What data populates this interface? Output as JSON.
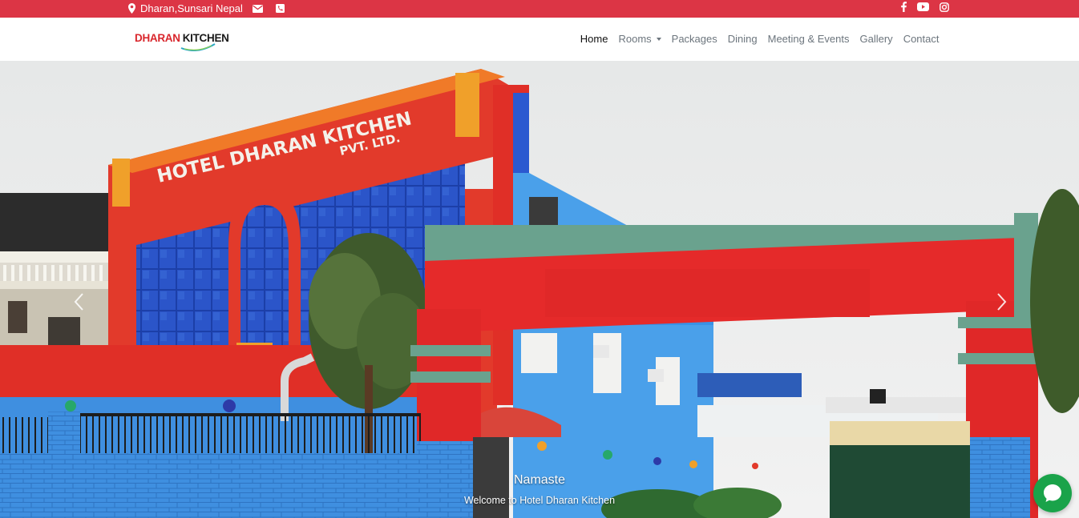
{
  "topbar": {
    "location": "Dharan,Sunsari Nepal",
    "left_icons": [
      "map-marker-icon",
      "envelope-icon",
      "phone-square-icon"
    ],
    "right_icons": [
      "facebook-icon",
      "youtube-icon",
      "instagram-icon"
    ],
    "color": "#dc3545"
  },
  "brand": {
    "word1": "DHARAN",
    "word2": "KITCHEN"
  },
  "nav": {
    "items": [
      {
        "label": "Home",
        "active": true
      },
      {
        "label": "Rooms",
        "dropdown": true
      },
      {
        "label": "Packages"
      },
      {
        "label": "Dining"
      },
      {
        "label": "Meeting & Events"
      },
      {
        "label": "Gallery"
      },
      {
        "label": "Contact"
      }
    ]
  },
  "hero": {
    "sign_title": "HOTEL DHARAN KITCHEN",
    "sign_sub": "PVT. LTD.",
    "caption_title": "Namaste",
    "caption_text": "Welcome to Hotel Dharan Kitchen",
    "controls": [
      "chevron-left-icon",
      "chevron-right-icon"
    ]
  },
  "chat": {
    "icon": "chat-bubble-icon",
    "color": "#1aa34a"
  }
}
